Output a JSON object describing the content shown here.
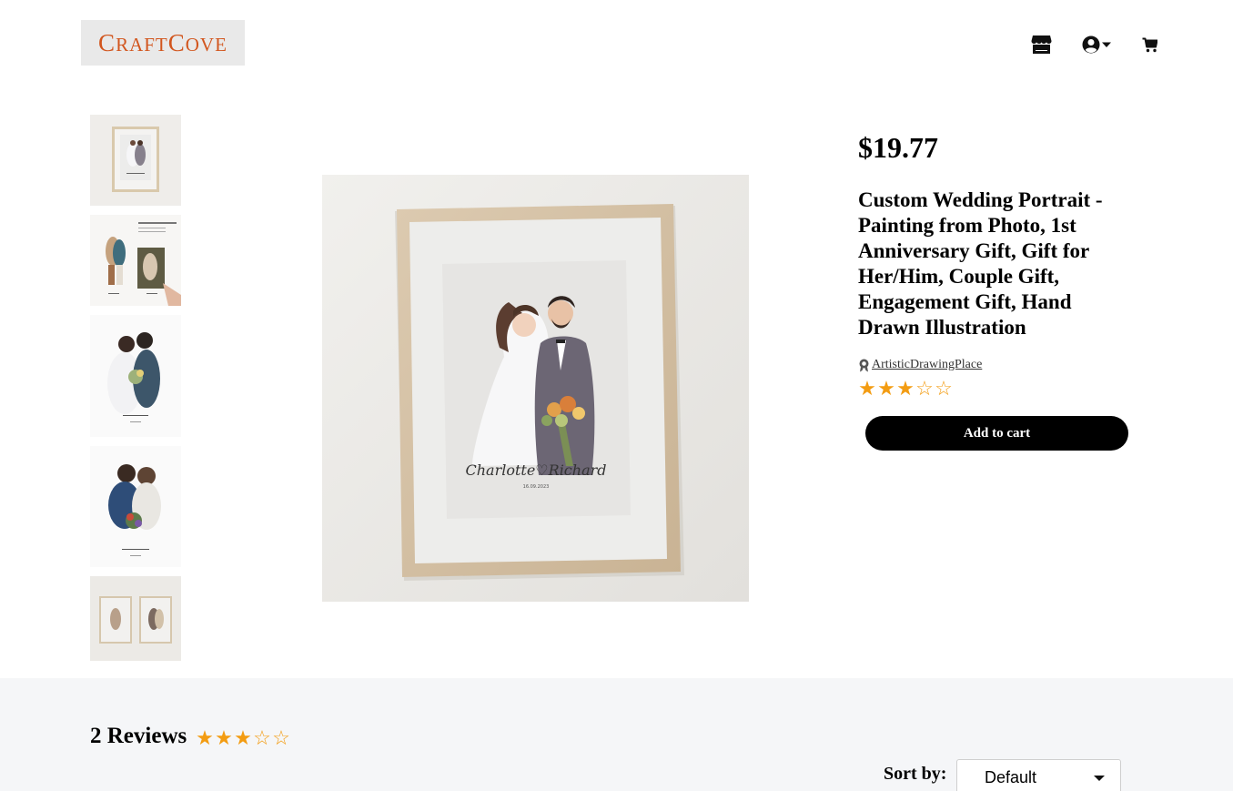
{
  "header": {
    "logo_text_big1": "C",
    "logo_text_small1": "RAFT",
    "logo_text_big2": "C",
    "logo_text_small2": "OVE",
    "icons": [
      "store-icon",
      "user-circle-icon",
      "caret-down-icon",
      "cart-icon"
    ]
  },
  "product": {
    "price": "$19.77",
    "title": "Custom Wedding Portrait - Painting from Photo, 1st Anniversary Gift, Gift for Her/Him, Couple Gift, Engagement Gift, Hand Drawn Illustration",
    "seller": "ArtisticDrawingPlace",
    "rating": 3,
    "rating_max": 5,
    "add_to_cart_label": "Add to cart",
    "artwork_names": "Charlotte♡Richard",
    "artwork_date": "16.09.2023",
    "thumbnails": [
      "thumbnail-framed-portrait",
      "thumbnail-photo-to-drawing",
      "thumbnail-couple-drawing",
      "thumbnail-couple-bouquet",
      "thumbnail-two-frames"
    ]
  },
  "reviews": {
    "title": "2 Reviews",
    "rating": 3,
    "rating_max": 5,
    "sort_label": "Sort by:",
    "sort_value": "Default"
  },
  "colors": {
    "logo": "#d2561e",
    "star": "#f39c12",
    "button_bg": "#000000",
    "reviews_bg": "#f5f6f8"
  }
}
